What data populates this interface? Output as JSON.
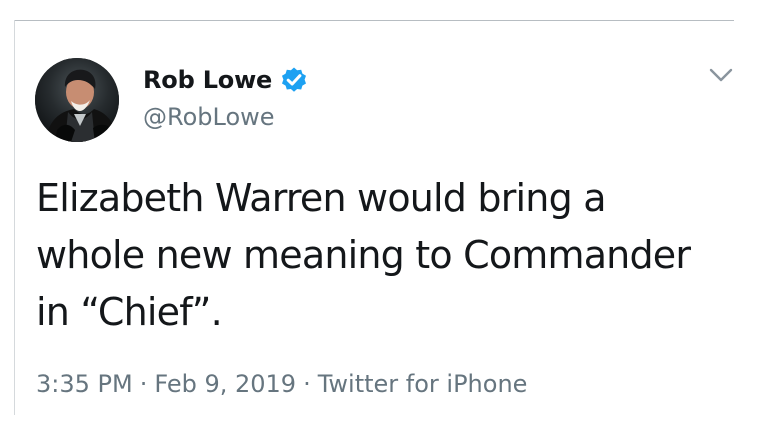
{
  "author": {
    "name": "Rob Lowe",
    "handle": "@RobLowe",
    "verified_color": "#1da1f2",
    "avatar_icon": "profile-photo-avatar"
  },
  "tweet": {
    "lines": [
      "Elizabeth Warren would bring a",
      "whole new meaning to Commander",
      "in “Chief”."
    ]
  },
  "meta": {
    "time": "3:35 PM",
    "separator": "·",
    "date": "Feb 9, 2019",
    "source": "Twitter for iPhone"
  },
  "icons": {
    "verified": "verified-badge-icon",
    "menu": "chevron-down-icon"
  },
  "colors": {
    "text": "#14171a",
    "secondary": "#66757f",
    "accent": "#1da1f2",
    "divider": "#b7bdc2"
  }
}
